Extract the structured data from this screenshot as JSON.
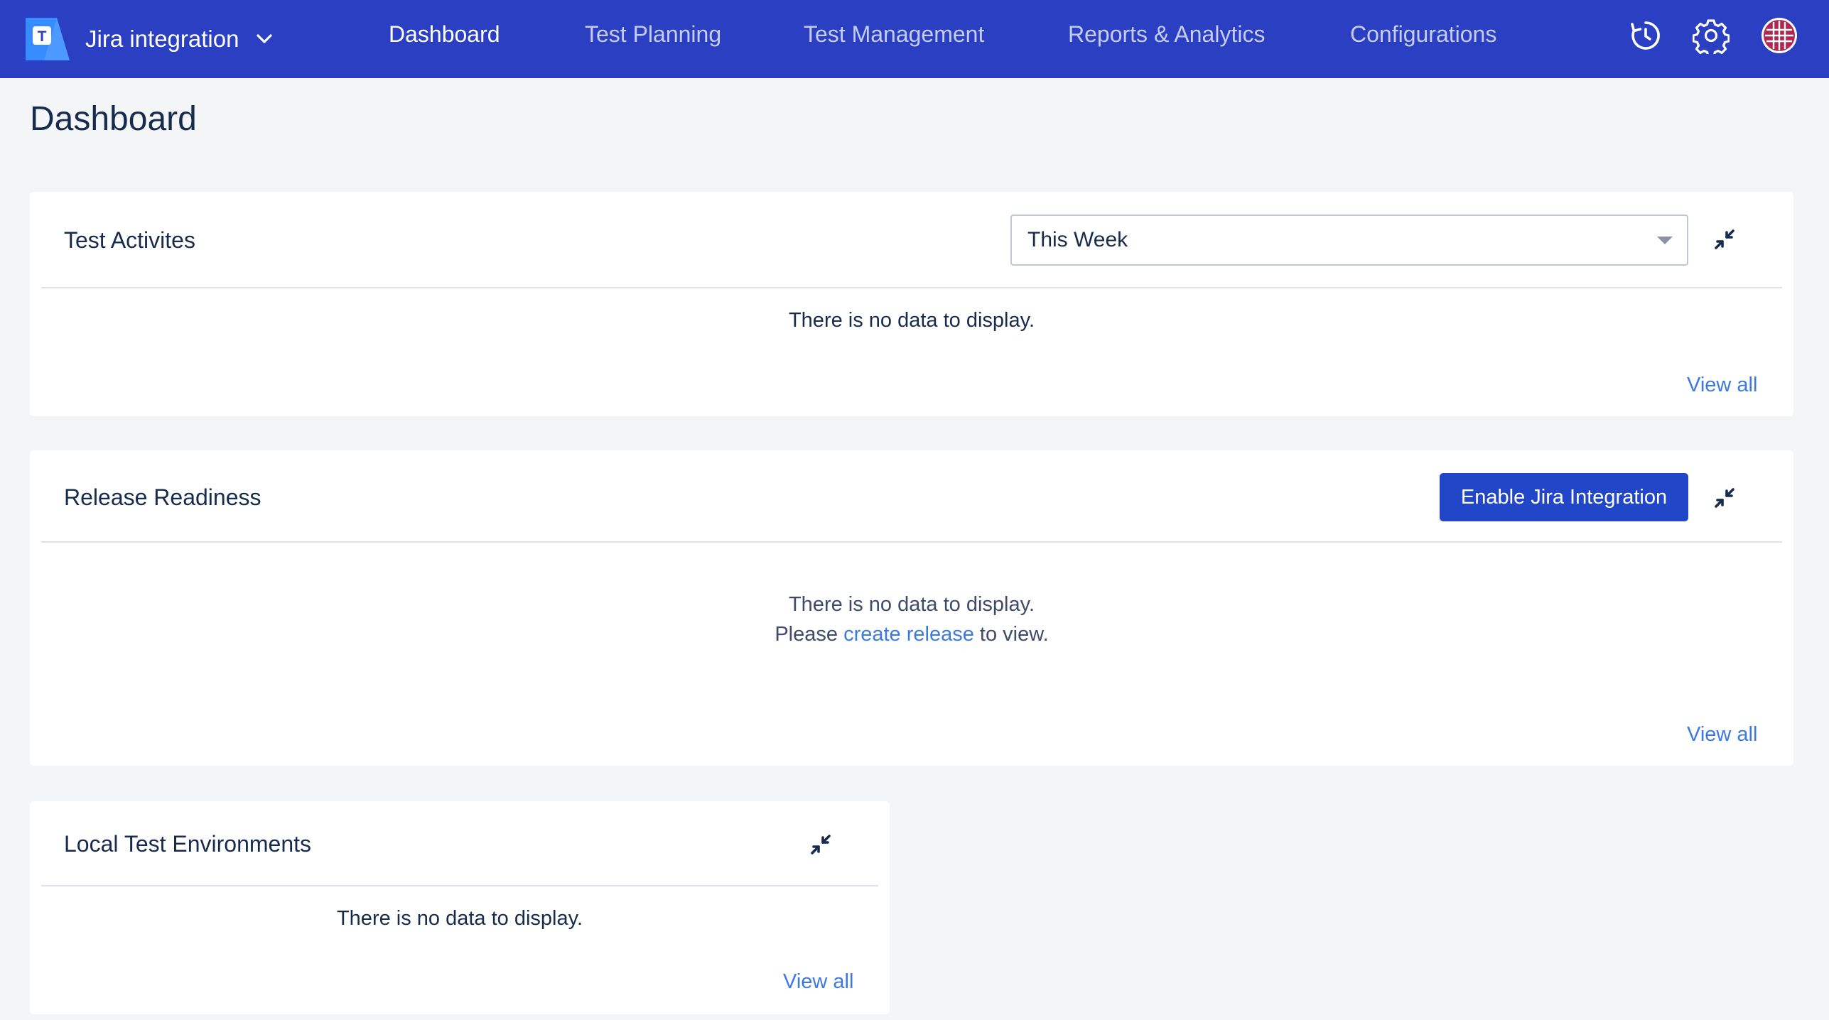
{
  "header": {
    "project_name": "Jira integration",
    "nav": [
      {
        "label": "Dashboard",
        "active": true
      },
      {
        "label": "Test Planning",
        "active": false
      },
      {
        "label": "Test Management",
        "active": false
      },
      {
        "label": "Reports & Analytics",
        "active": false
      },
      {
        "label": "Configurations",
        "active": false
      }
    ],
    "icons": [
      "logo-icon",
      "chevron-down-icon",
      "history-icon",
      "gear-icon",
      "avatar"
    ]
  },
  "page": {
    "title": "Dashboard"
  },
  "cards": {
    "test_activities": {
      "title": "Test Activites",
      "period_select": "This Week",
      "empty_text": "There is no data to display.",
      "view_all": "View all"
    },
    "release_readiness": {
      "title": "Release Readiness",
      "button": "Enable Jira Integration",
      "empty_text": "There is no data to display.",
      "hint_prefix": "Please ",
      "hint_link": "create release",
      "hint_suffix": " to view.",
      "view_all": "View all"
    },
    "local_envs": {
      "title": "Local Test Environments",
      "empty_text": "There is no data to display.",
      "view_all": "View all"
    }
  },
  "colors": {
    "header_bg": "#2b3fc2",
    "primary": "#2146c7",
    "link": "#3d7ae0",
    "page_bg": "#f4f5f7"
  }
}
